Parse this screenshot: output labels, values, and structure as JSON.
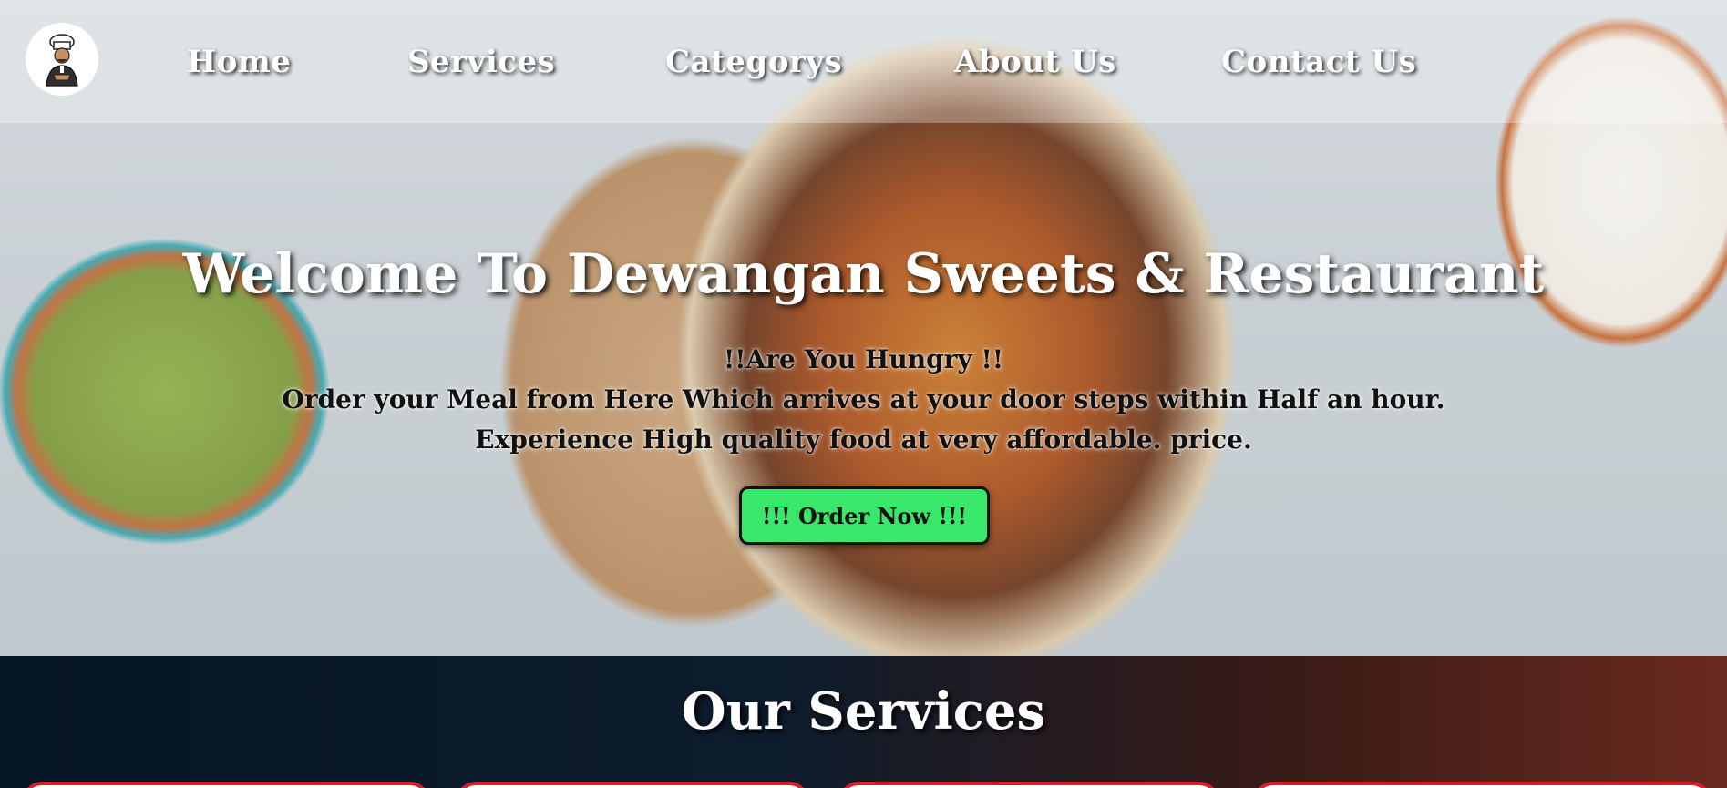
{
  "brand": {
    "logo_icon": "chef-logo-icon"
  },
  "nav": {
    "items": [
      {
        "label": "Home"
      },
      {
        "label": "Services"
      },
      {
        "label": "Categorys"
      },
      {
        "label": "About Us"
      },
      {
        "label": "Contact Us"
      }
    ]
  },
  "hero": {
    "title": "Welcome To Dewangan Sweets & Restaurant",
    "tagline": "!!Are You Hungry !!",
    "line1": "Order your Meal from Here Which arrives at your door steps within Half an hour.",
    "line2": "Experience High quality food at very affordable. price.",
    "cta_label": "!!! Order Now !!!",
    "cta_color": "#39e86a"
  },
  "services": {
    "title": "Our Services",
    "card_border_color": "#d61f2c"
  }
}
